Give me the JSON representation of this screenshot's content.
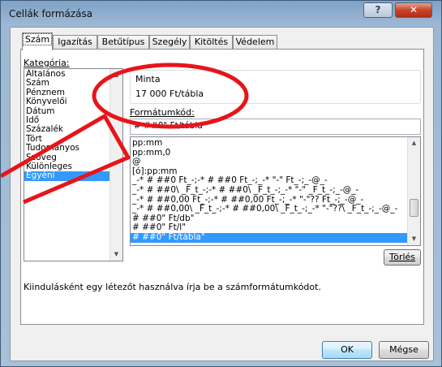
{
  "window": {
    "title": "Cellák formázása",
    "help_glyph": "?",
    "close_glyph": "✕"
  },
  "tabs": [
    {
      "label": "Szám",
      "active": true
    },
    {
      "label": "Igazítás"
    },
    {
      "label": "Betűtípus"
    },
    {
      "label": "Szegély"
    },
    {
      "label": "Kitöltés"
    },
    {
      "label": "Védelem"
    }
  ],
  "category": {
    "label": "Kategória:",
    "items": [
      "Általános",
      "Szám",
      "Pénznem",
      "Könyvelői",
      "Dátum",
      "Idő",
      "Százalék",
      "Tört",
      "Tudományos",
      "Szöveg",
      "Különleges",
      "Egyéni"
    ],
    "selected": "Egyéni"
  },
  "sample": {
    "label": "Minta",
    "value": "17 000 Ft/tábla"
  },
  "format_code": {
    "label": "Formátumkód:",
    "value": "# ##0\" Ft/tábla\"",
    "items": [
      "pp:mm",
      "pp:mm,0",
      "@",
      "[ó]:pp:mm",
      "_-* # ##0 Ft_-;-* # ##0 Ft_-;_-* \"-\" Ft_-;_-@_-",
      "_-* # ##0\\ _F_t_-;-* # ##0\\ _F_t_-;_-* \"-\" _F_t_-;_-@_-",
      "_-* # ##0,00 Ft_-;-* # ##0,00 Ft_-;_-* \"-\"?? Ft_-;_-@_-",
      "_-* # ##0,00\\ _F_t_-;-* # ##0,00\\ _F_t_-;_-* \"-\"??\\ _F_t_-;_-@_-",
      "# ##0\" Ft/db\"",
      "# ##0\" Ft/l\"",
      "# ##0\" Ft/tábla\""
    ],
    "selected_index": 10
  },
  "delete_button": "Törlés",
  "hint": "Kiindulásként egy létezőt használva írja be a számformátumkódot.",
  "ok_button": "OK",
  "cancel_button": "Mégse",
  "colors": {
    "accent_select": "#3399ff",
    "annotation": "#e8141b"
  }
}
